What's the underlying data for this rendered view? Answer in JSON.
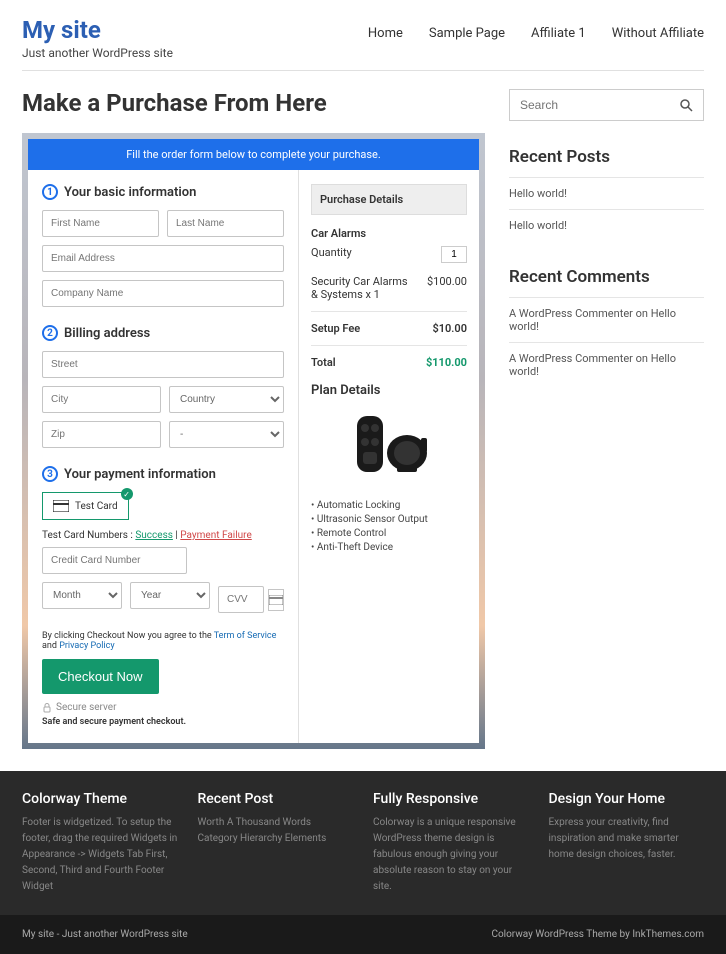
{
  "header": {
    "title": "My site",
    "tagline": "Just another WordPress site",
    "nav": [
      "Home",
      "Sample Page",
      "Affiliate 1",
      "Without Affiliate"
    ]
  },
  "page": {
    "title": "Make a Purchase From Here"
  },
  "order": {
    "banner": "Fill the order form below to complete your purchase.",
    "sec1": "Your basic information",
    "sec2": "Billing address",
    "sec3": "Your payment information",
    "ph": {
      "first": "First Name",
      "last": "Last Name",
      "email": "Email Address",
      "company": "Company Name",
      "street": "Street",
      "city": "City",
      "country": "Country",
      "zip": "Zip",
      "phoneCode": "-",
      "cc": "Credit Card Number",
      "month": "Month",
      "year": "Year",
      "cvv": "CVV"
    },
    "testCard": "Test Card",
    "testNote": {
      "pre": "Test Card Numbers : ",
      "success": "Success",
      "sep": " | ",
      "fail": "Payment Failure"
    },
    "termsPre": "By clicking Checkout Now you agree to the ",
    "termsTos": "Term of Service",
    "termsAnd": " and ",
    "termsPriv": "Privacy Policy",
    "checkout": "Checkout Now",
    "secure": "Secure server",
    "safe": "Safe and secure payment checkout."
  },
  "purchase": {
    "head": "Purchase Details",
    "item": "Car Alarms",
    "qtyLabel": "Quantity",
    "qty": "1",
    "desc": "Security Car Alarms & Systems x 1",
    "descPrice": "$100.00",
    "setup": "Setup Fee",
    "setupPrice": "$10.00",
    "totalLabel": "Total",
    "total": "$110.00",
    "planHead": "Plan Details",
    "features": [
      "Automatic Locking",
      "Ultrasonic Sensor Output",
      "Remote Control",
      "Anti-Theft Device"
    ]
  },
  "sidebar": {
    "searchPh": "Search",
    "recentPosts": {
      "title": "Recent Posts",
      "items": [
        "Hello world!",
        "Hello world!"
      ]
    },
    "recentComments": {
      "title": "Recent Comments",
      "items": [
        {
          "author": "A WordPress Commenter",
          "on": " on ",
          "post": "Hello world!"
        },
        {
          "author": "A WordPress Commenter",
          "on": " on ",
          "post": "Hello world!"
        }
      ]
    }
  },
  "footer": {
    "cols": [
      {
        "h": "Colorway Theme",
        "p": "Footer is widgetized. To setup the footer, drag the required Widgets in Appearance -> Widgets Tab First, Second, Third and Fourth Footer Widget"
      },
      {
        "h": "Recent Post",
        "p": "Worth A Thousand Words Category Hierarchy Elements"
      },
      {
        "h": "Fully Responsive",
        "p": "Colorway is a unique responsive WordPress theme design is fabulous enough giving your absolute reason to stay on your site."
      },
      {
        "h": "Design Your Home",
        "p": "Express your creativity, find inspiration and make smarter home design choices, faster."
      }
    ],
    "barLeft": "My site - Just another WordPress site",
    "barRight": "Colorway WordPress Theme by InkThemes.com"
  }
}
